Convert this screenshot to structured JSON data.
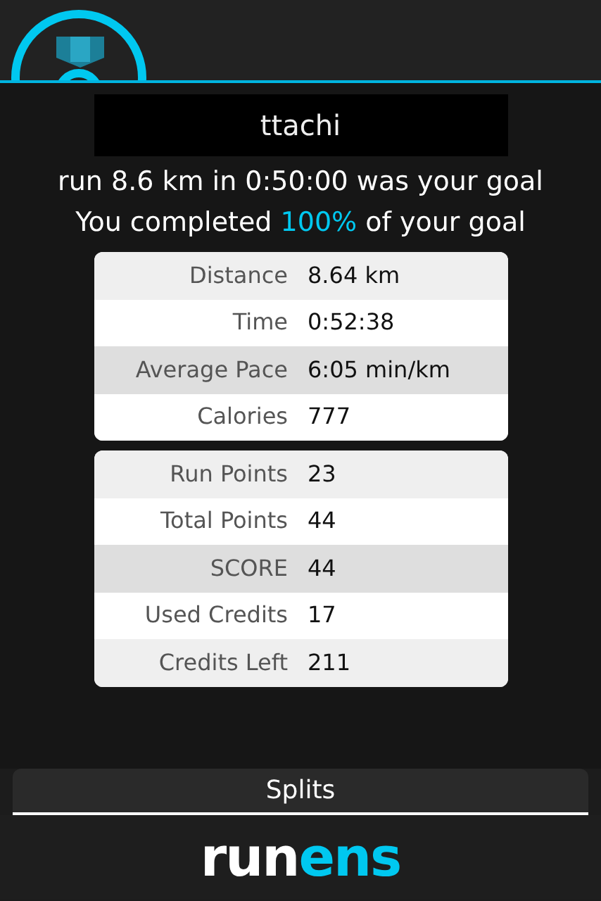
{
  "user_name": "ttachi",
  "goal_text": "run 8.6 km in 0:50:00 was your goal",
  "completion": {
    "before": "You completed",
    "value": "100%",
    "after": "of your goal"
  },
  "stats_cards": [
    {
      "rows": [
        {
          "label": "Distance",
          "value": "8.64 km",
          "highlighted": false
        },
        {
          "label": "Time",
          "value": "0:52:38",
          "highlighted": false
        },
        {
          "label": "Average Pace",
          "value": "6:05 min/km",
          "highlighted": true
        },
        {
          "label": "Calories",
          "value": "777",
          "highlighted": false
        }
      ]
    },
    {
      "rows": [
        {
          "label": "Run Points",
          "value": "23",
          "highlighted": false
        },
        {
          "label": "Total Points",
          "value": "44",
          "highlighted": false
        },
        {
          "label": "SCORE",
          "value": "44",
          "highlighted": true
        },
        {
          "label": "Used Credits",
          "value": "17",
          "highlighted": false
        },
        {
          "label": "Credits Left",
          "value": "211",
          "highlighted": false
        }
      ]
    }
  ],
  "splits_tab": {
    "label": "Splits",
    "selected": true
  },
  "logo": [
    {
      "text": "run",
      "color": "#ffffff"
    },
    {
      "text": "ens",
      "color": "#00c8f0"
    }
  ]
}
